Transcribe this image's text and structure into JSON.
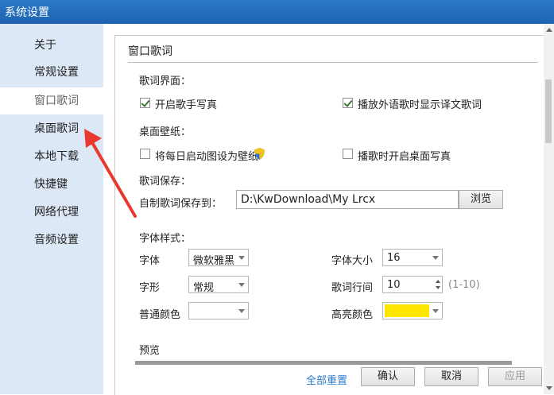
{
  "window": {
    "title": "系统设置"
  },
  "sidebar": {
    "items": [
      {
        "label": "关于"
      },
      {
        "label": "常规设置"
      },
      {
        "label": "窗口歌词"
      },
      {
        "label": "桌面歌词"
      },
      {
        "label": "本地下载"
      },
      {
        "label": "快捷键"
      },
      {
        "label": "网络代理"
      },
      {
        "label": "音频设置"
      }
    ],
    "active_index": 2
  },
  "main": {
    "section_title": "窗口歌词",
    "lyrics_ui": {
      "heading": "歌词界面：",
      "show_singer_photo": {
        "label": "开启歌手写真",
        "checked": true
      },
      "show_translation": {
        "label": "播放外语歌时显示译文歌词",
        "checked": true
      }
    },
    "wallpaper": {
      "heading": "桌面壁纸：",
      "set_daily_wallpaper": {
        "label": "将每日启动图设为壁纸",
        "checked": false
      },
      "desktop_photo": {
        "label": "播歌时开启桌面写真",
        "checked": false
      }
    },
    "save": {
      "heading": "歌词保存：",
      "path_label": "自制歌词保存到：",
      "path_value": "D:\\KwDownload\\My Lrcx",
      "browse_label": "浏览"
    },
    "font_style": {
      "heading": "字体样式：",
      "font_label": "字体",
      "font_value": "微软雅黑",
      "size_label": "字体大小",
      "size_value": "16",
      "shape_label": "字形",
      "shape_value": "常规",
      "line_spacing_label": "歌词行间",
      "line_spacing_value": "10",
      "line_spacing_range": "(1-10)",
      "normal_color_label": "普通颜色",
      "normal_color": "#ffffff",
      "highlight_color_label": "高亮颜色",
      "highlight_color": "#ffe600"
    },
    "preview": {
      "label": "预览"
    }
  },
  "footer": {
    "reset_label": "全部重置",
    "ok_label": "确认",
    "cancel_label": "取消",
    "apply_label": "应用"
  }
}
